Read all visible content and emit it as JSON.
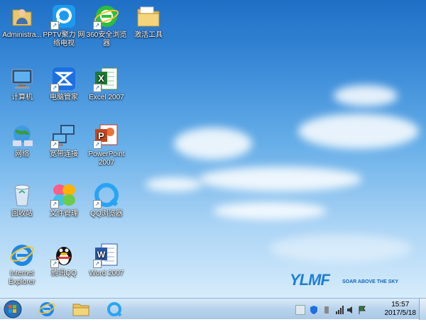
{
  "desktop": {
    "icons": [
      {
        "id": "administrator",
        "label": "Administra...",
        "icon": "user-folder-icon",
        "shortcut": false
      },
      {
        "id": "pptv",
        "label": "PPTV聚力 网络电视",
        "icon": "pptv-icon",
        "shortcut": true
      },
      {
        "id": "browser-360",
        "label": "360安全浏览器",
        "icon": "360-browser-icon",
        "shortcut": true
      },
      {
        "id": "tools",
        "label": "激活工具",
        "icon": "folder-icon",
        "shortcut": false
      },
      {
        "id": "computer",
        "label": "计算机",
        "icon": "computer-icon",
        "shortcut": false
      },
      {
        "id": "pc-manager",
        "label": "电脑管家",
        "icon": "pc-manager-icon",
        "shortcut": true
      },
      {
        "id": "excel",
        "label": "Excel 2007",
        "icon": "excel-icon",
        "shortcut": true
      },
      {
        "id": "network",
        "label": "网络",
        "icon": "network-icon",
        "shortcut": false
      },
      {
        "id": "broadband",
        "label": "宽带连接",
        "icon": "broadband-icon",
        "shortcut": true
      },
      {
        "id": "powerpoint",
        "label": "PowerPoint 2007",
        "icon": "powerpoint-icon",
        "shortcut": true
      },
      {
        "id": "recycle-bin",
        "label": "回收站",
        "icon": "recycle-bin-icon",
        "shortcut": false
      },
      {
        "id": "file-manager",
        "label": "文件管理",
        "icon": "file-manager-icon",
        "shortcut": true
      },
      {
        "id": "qq-browser",
        "label": "QQ浏览器",
        "icon": "qq-browser-icon",
        "shortcut": true
      },
      {
        "id": "ie",
        "label": "Internet Explorer",
        "icon": "ie-icon",
        "shortcut": false
      },
      {
        "id": "qq",
        "label": "腾讯QQ",
        "icon": "qq-penguin-icon",
        "shortcut": true
      },
      {
        "id": "word",
        "label": "Word 2007",
        "icon": "word-icon",
        "shortcut": true
      }
    ],
    "logo": {
      "brand": "YLMF",
      "slogan": "SOAR ABOVE THE SKY"
    }
  },
  "taskbar": {
    "pinned": [
      {
        "id": "ie",
        "icon": "ie-icon"
      },
      {
        "id": "explorer",
        "icon": "folder-icon"
      },
      {
        "id": "qq-browser",
        "icon": "qq-browser-icon"
      }
    ],
    "tray_icons": [
      "keyboard-icon",
      "shield-icon",
      "pen-icon",
      "network-signal-icon",
      "volume-icon",
      "flag-icon"
    ],
    "clock": {
      "time": "15:57",
      "date": "2017/5/18"
    }
  },
  "colors": {
    "accent": "#1f7ed6",
    "taskbar": "#b8d3ec"
  }
}
